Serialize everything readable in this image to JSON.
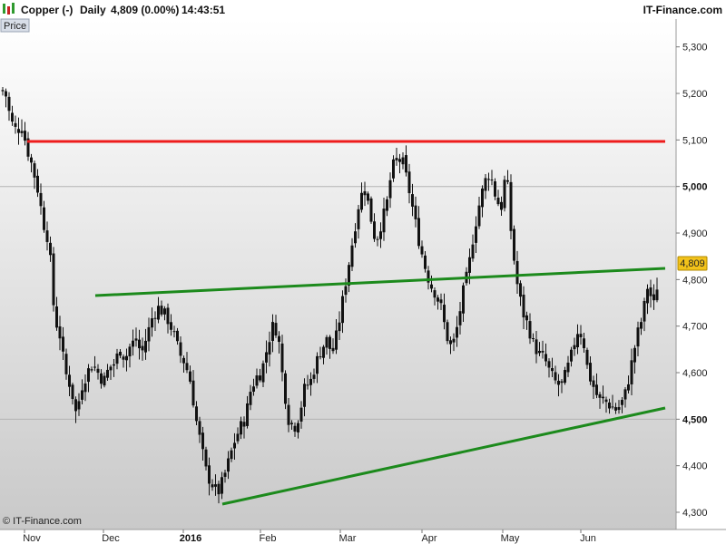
{
  "header": {
    "instrument": "Copper (-)",
    "period": "Daily",
    "quote": "4,809 (0.00%)",
    "time": "14:43:51",
    "brand": "IT-Finance.com"
  },
  "panel_label": "Price",
  "copyright": "© IT-Finance.com",
  "colors": {
    "resistance": "#ee1c1c",
    "trendline": "#1c8a1c",
    "candle": "#111111",
    "price_tag": "#f2c21a"
  },
  "chart_data": {
    "type": "candlestick",
    "y_ticks": [
      "4,300",
      "4,400",
      "4,500",
      "4,600",
      "4,700",
      "4,800",
      "4,900",
      "5,000",
      "5,100",
      "5,200",
      "5,300"
    ],
    "y_tick_values": [
      4300,
      4400,
      4500,
      4600,
      4700,
      4800,
      4900,
      5000,
      5100,
      5200,
      5300
    ],
    "major_ticks": [
      "4,500",
      "5,000"
    ],
    "x_labels": [
      "Nov",
      "Dec",
      "2016",
      "Feb",
      "Mar",
      "Apr",
      "May",
      "Jun"
    ],
    "bold_x_labels": [
      "2016"
    ],
    "ylim": [
      4270,
      5330
    ],
    "last_price": "4,809",
    "last_value": 4809,
    "close_path": [
      [
        0,
        5210
      ],
      [
        6,
        5200
      ],
      [
        12,
        5140
      ],
      [
        18,
        5120
      ],
      [
        24,
        5130
      ],
      [
        30,
        5080
      ],
      [
        36,
        5040
      ],
      [
        42,
        4990
      ],
      [
        48,
        4920
      ],
      [
        54,
        4880
      ],
      [
        60,
        4720
      ],
      [
        66,
        4680
      ],
      [
        72,
        4600
      ],
      [
        78,
        4570
      ],
      [
        84,
        4510
      ],
      [
        90,
        4570
      ],
      [
        96,
        4600
      ],
      [
        102,
        4620
      ],
      [
        108,
        4600
      ],
      [
        114,
        4580
      ],
      [
        120,
        4610
      ],
      [
        126,
        4620
      ],
      [
        132,
        4650
      ],
      [
        138,
        4630
      ],
      [
        144,
        4660
      ],
      [
        150,
        4670
      ],
      [
        156,
        4640
      ],
      [
        162,
        4680
      ],
      [
        168,
        4720
      ],
      [
        174,
        4740
      ],
      [
        180,
        4730
      ],
      [
        186,
        4710
      ],
      [
        192,
        4680
      ],
      [
        198,
        4640
      ],
      [
        204,
        4620
      ],
      [
        210,
        4580
      ],
      [
        216,
        4500
      ],
      [
        222,
        4440
      ],
      [
        228,
        4380
      ],
      [
        234,
        4360
      ],
      [
        240,
        4340
      ],
      [
        246,
        4370
      ],
      [
        252,
        4410
      ],
      [
        258,
        4450
      ],
      [
        264,
        4480
      ],
      [
        270,
        4500
      ],
      [
        276,
        4560
      ],
      [
        282,
        4590
      ],
      [
        288,
        4600
      ],
      [
        294,
        4650
      ],
      [
        300,
        4700
      ],
      [
        306,
        4690
      ],
      [
        312,
        4580
      ],
      [
        318,
        4500
      ],
      [
        324,
        4480
      ],
      [
        330,
        4510
      ],
      [
        336,
        4570
      ],
      [
        342,
        4580
      ],
      [
        348,
        4620
      ],
      [
        354,
        4650
      ],
      [
        360,
        4670
      ],
      [
        366,
        4640
      ],
      [
        372,
        4690
      ],
      [
        378,
        4760
      ],
      [
        384,
        4830
      ],
      [
        390,
        4900
      ],
      [
        396,
        4970
      ],
      [
        402,
        5000
      ],
      [
        408,
        4940
      ],
      [
        414,
        4880
      ],
      [
        420,
        4920
      ],
      [
        426,
        4960
      ],
      [
        432,
        5040
      ],
      [
        438,
        5060
      ],
      [
        444,
        5050
      ],
      [
        450,
        5000
      ],
      [
        456,
        4940
      ],
      [
        462,
        4880
      ],
      [
        468,
        4830
      ],
      [
        474,
        4790
      ],
      [
        480,
        4770
      ],
      [
        486,
        4740
      ],
      [
        492,
        4680
      ],
      [
        498,
        4650
      ],
      [
        504,
        4700
      ],
      [
        510,
        4770
      ],
      [
        516,
        4820
      ],
      [
        522,
        4900
      ],
      [
        528,
        4960
      ],
      [
        534,
        5010
      ],
      [
        540,
        5030
      ],
      [
        546,
        4980
      ],
      [
        552,
        4950
      ],
      [
        558,
        5040
      ],
      [
        564,
        4880
      ],
      [
        570,
        4790
      ],
      [
        576,
        4730
      ],
      [
        582,
        4700
      ],
      [
        588,
        4660
      ],
      [
        594,
        4640
      ],
      [
        600,
        4630
      ],
      [
        606,
        4600
      ],
      [
        612,
        4580
      ],
      [
        618,
        4570
      ],
      [
        624,
        4600
      ],
      [
        630,
        4640
      ],
      [
        636,
        4690
      ],
      [
        642,
        4680
      ],
      [
        648,
        4600
      ],
      [
        654,
        4570
      ],
      [
        660,
        4540
      ],
      [
        666,
        4540
      ],
      [
        672,
        4530
      ],
      [
        678,
        4520
      ],
      [
        684,
        4530
      ],
      [
        690,
        4560
      ],
      [
        696,
        4620
      ],
      [
        702,
        4680
      ],
      [
        708,
        4720
      ],
      [
        714,
        4790
      ],
      [
        720,
        4740
      ],
      [
        726,
        4809
      ]
    ]
  }
}
